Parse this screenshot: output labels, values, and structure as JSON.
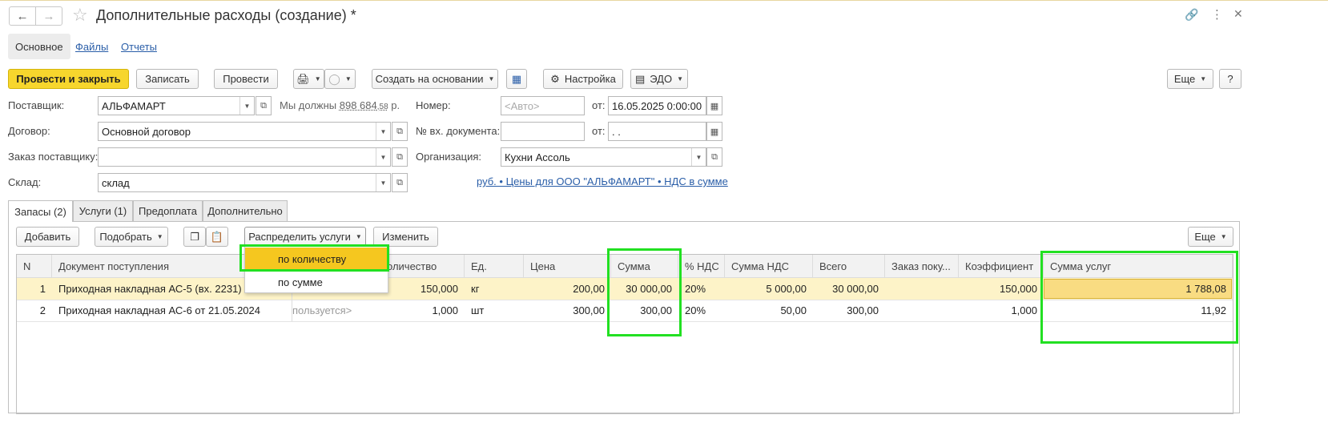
{
  "window": {
    "title": "Дополнительные расходы (создание) *",
    "back_icon": "arrow-left-icon",
    "forward_icon": "arrow-right-icon",
    "star_icon": "star-icon",
    "link_icon": "link-icon",
    "more_icon": "kebab-icon",
    "close_icon": "close-icon"
  },
  "top_tabs": [
    "Основное",
    "Файлы",
    "Отчеты"
  ],
  "toolbar": {
    "post_close": "Провести и закрыть",
    "save": "Записать",
    "post": "Провести",
    "create_based": "Создать на основании",
    "settings": "Настройка",
    "edo": "ЭДО",
    "more": "Еще",
    "help": "?"
  },
  "form": {
    "supplier_label": "Поставщик:",
    "supplier_value": "АЛЬФАМАРТ",
    "debt_prefix": "Мы должны",
    "debt_int": "898 684",
    "debt_frac": ",58",
    "debt_suffix": "р.",
    "contract_label": "Договор:",
    "contract_value": "Основной договор",
    "order_label": "Заказ поставщику:",
    "order_value": "",
    "warehouse_label": "Склад:",
    "warehouse_value": "склад",
    "number_label": "Номер:",
    "number_placeholder": "<Авто>",
    "from_label": "от:",
    "date_value": "16.05.2025  0:00:00",
    "in_doc_label": "№ вх. документа:",
    "in_doc_value": "",
    "from2_label": "от:",
    "in_date_value": " .  .",
    "org_label": "Организация:",
    "org_value": "Кухни Ассоль",
    "prices_link": "руб. • Цены для ООО \"АЛЬФАМАРТ\" • НДС в сумме"
  },
  "doc_tabs": [
    "Запасы (2)",
    "Услуги (1)",
    "Предоплата",
    "Дополнительно"
  ],
  "table_toolbar": {
    "add": "Добавить",
    "pick": "Подобрать",
    "distribute": "Распределить услуги",
    "change": "Изменить",
    "more": "Еще"
  },
  "popup_menu": [
    "по количеству",
    "по сумме"
  ],
  "table": {
    "columns": [
      "N",
      "Документ поступления",
      "Количество",
      "Ед.",
      "Цена",
      "Сумма",
      "% НДС",
      "Сумма НДС",
      "Всего",
      "Заказ поку...",
      "Коэффициент",
      "Сумма услуг"
    ],
    "header_partial_qty": "оличество",
    "rows": [
      {
        "n": "1",
        "doc": "Приходная накладная АС-5 (вх. 2231) от",
        "mid": "",
        "qty": "150,000",
        "unit": "кг",
        "price": "200,00",
        "sum": "30 000,00",
        "vat": "20%",
        "vat_sum": "5 000,00",
        "total": "30 000,00",
        "order": "",
        "coef": "150,000",
        "services": "1 788,08"
      },
      {
        "n": "2",
        "doc": "Приходная накладная АС-6 от 21.05.2024",
        "mid": "пользуется>",
        "qty": "1,000",
        "unit": "шт",
        "price": "300,00",
        "sum": "300,00",
        "vat": "20%",
        "vat_sum": "50,00",
        "total": "300,00",
        "order": "",
        "coef": "1,000",
        "services": "11,92"
      }
    ]
  },
  "colors": {
    "primary_button": "#f7d62d",
    "highlight_box": "#22e022",
    "selected_row": "#fdf3c8",
    "link": "#2a5ea8"
  }
}
